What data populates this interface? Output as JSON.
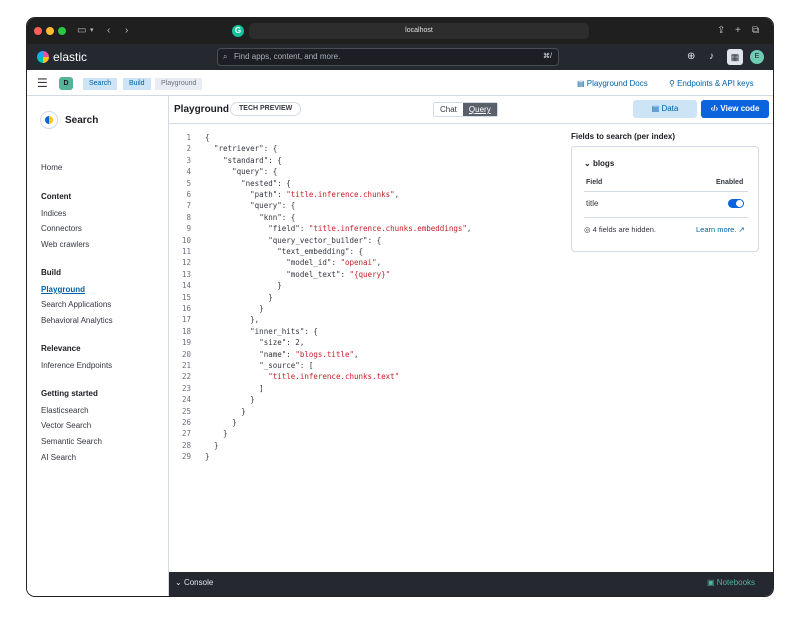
{
  "browser": {
    "url": "localhost",
    "icons": [
      "sidebar-icon",
      "back-icon",
      "forward-icon",
      "share-icon",
      "new-tab-icon",
      "tabs-icon"
    ]
  },
  "header": {
    "logo_text": "elastic",
    "search_placeholder": "Find apps, content, and more.",
    "search_shortcut": "⌘/",
    "avatar_initial": "E"
  },
  "breadcrumbs": {
    "space_initial": "D",
    "items": [
      "Search",
      "Build",
      "Playground"
    ],
    "playground_docs": "Playground Docs",
    "endpoints": "Endpoints & API keys"
  },
  "sidenav": {
    "title": "Search",
    "home": "Home",
    "groups": [
      {
        "title": "Content",
        "items": [
          "Indices",
          "Connectors",
          "Web crawlers"
        ]
      },
      {
        "title": "Build",
        "items": [
          "Playground",
          "Search Applications",
          "Behavioral Analytics"
        ]
      },
      {
        "title": "Relevance",
        "items": [
          "Inference Endpoints"
        ]
      },
      {
        "title": "Getting started",
        "items": [
          "Elasticsearch",
          "Vector Search",
          "Semantic Search",
          "AI Search"
        ]
      }
    ]
  },
  "page": {
    "title": "Playground",
    "badge": "TECH PREVIEW",
    "chat_label": "Chat",
    "query_label": "Query",
    "data_label": "Data",
    "view_code_label": "View code"
  },
  "code_lines": [
    "{",
    "  \"retriever\": {",
    "    \"standard\": {",
    "      \"query\": {",
    "        \"nested\": {",
    "          \"path\": \"title.inference.chunks\",",
    "          \"query\": {",
    "            \"knn\": {",
    "              \"field\": \"title.inference.chunks.embeddings\",",
    "              \"query_vector_builder\": {",
    "                \"text_embedding\": {",
    "                  \"model_id\": \"openai\",",
    "                  \"model_text\": \"{query}\"",
    "                }",
    "              }",
    "            }",
    "          },",
    "          \"inner_hits\": {",
    "            \"size\": 2,",
    "            \"name\": \"blogs.title\",",
    "            \"_source\": [",
    "              \"title.inference.chunks.text\"",
    "            ]",
    "          }",
    "        }",
    "      }",
    "    }",
    "  }",
    "}"
  ],
  "fields": {
    "title": "Fields to search (per index)",
    "index": "blogs",
    "col_field": "Field",
    "col_enabled": "Enabled",
    "row_field": "title",
    "row_enabled": true,
    "hidden_text": "4 fields are hidden.",
    "learn_more": "Learn more."
  },
  "console": {
    "label": "Console",
    "notebooks": "Notebooks"
  },
  "colors": {
    "primary": "#0b64dd",
    "header_bg": "#25282f",
    "string": "#c61e25"
  }
}
